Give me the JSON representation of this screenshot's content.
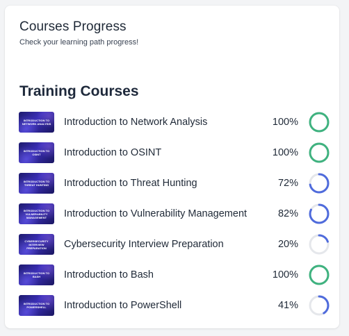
{
  "header": {
    "title": "Courses Progress",
    "subtitle": "Check your learning path progress!"
  },
  "section": {
    "title": "Training Courses"
  },
  "colors": {
    "complete": "#3fb27f",
    "in_progress": "#4f6bdc",
    "track": "#e5e7eb"
  },
  "courses": [
    {
      "name": "Introduction to Network Analysis",
      "progress": "100%",
      "value": 100,
      "thumb": "Introduction to Network Analysis"
    },
    {
      "name": "Introduction to OSINT",
      "progress": "100%",
      "value": 100,
      "thumb": "Introduction to OSINT"
    },
    {
      "name": "Introduction to Threat Hunting",
      "progress": "72%",
      "value": 72,
      "thumb": "Introduction to Threat Hunting"
    },
    {
      "name": "Introduction to Vulnerability Management",
      "progress": "82%",
      "value": 82,
      "thumb": "Introduction to Vulnerability Management"
    },
    {
      "name": "Cybersecurity Interview Preparation",
      "progress": "20%",
      "value": 20,
      "thumb": "Cybersecurity Interview Preparation"
    },
    {
      "name": "Introduction to Bash",
      "progress": "100%",
      "value": 100,
      "thumb": "Introduction to Bash"
    },
    {
      "name": "Introduction to PowerShell",
      "progress": "41%",
      "value": 41,
      "thumb": "Introduction to PowerShell"
    }
  ]
}
